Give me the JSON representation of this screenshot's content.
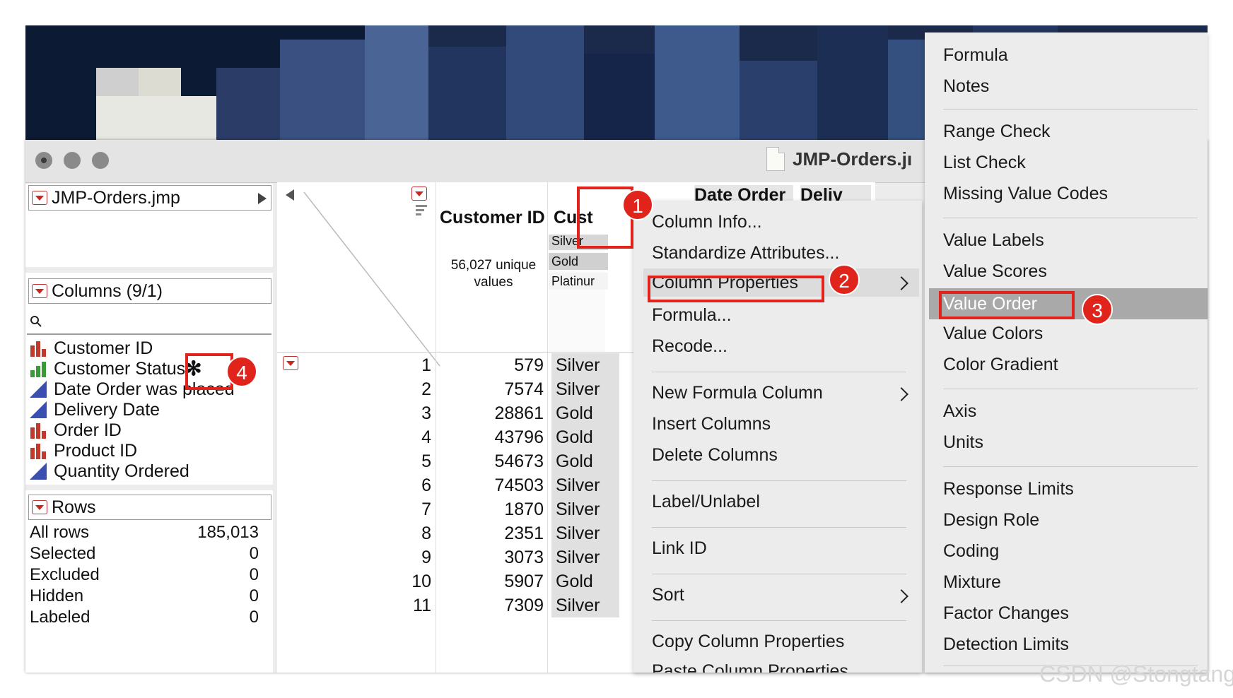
{
  "window": {
    "title": "JMP-Orders.jı"
  },
  "table_panel": {
    "title": "JMP-Orders.jmp"
  },
  "columns_panel": {
    "title": "Columns (9/1)",
    "items": [
      {
        "label": "Customer ID",
        "icon": "nominal-bar-icon",
        "color": "#c0392b"
      },
      {
        "label": "Customer Status",
        "icon": "ordinal-bar-icon",
        "color": "#3a9a3a"
      },
      {
        "label": "Date Order was placed",
        "icon": "continuous-triangle-icon",
        "color": "#3a4fb0"
      },
      {
        "label": "Delivery Date",
        "icon": "continuous-triangle-icon",
        "color": "#3a4fb0"
      },
      {
        "label": "Order ID",
        "icon": "nominal-bar-icon",
        "color": "#c0392b"
      },
      {
        "label": "Product ID",
        "icon": "nominal-bar-icon",
        "color": "#c0392b"
      },
      {
        "label": "Quantity Ordered",
        "icon": "continuous-triangle-icon",
        "color": "#3a4fb0"
      }
    ],
    "asterisk": "✻"
  },
  "rows_panel": {
    "title": "Rows",
    "stats": [
      {
        "label": "All rows",
        "value": "185,013"
      },
      {
        "label": "Selected",
        "value": "0"
      },
      {
        "label": "Excluded",
        "value": "0"
      },
      {
        "label": "Hidden",
        "value": "0"
      },
      {
        "label": "Labeled",
        "value": "0"
      }
    ]
  },
  "grid": {
    "col_customer_id": "Customer ID",
    "col_customer_status": "Cust",
    "col_date_order": "Date Order",
    "col_delivery": "Deliv",
    "summary": "56,027 unique values",
    "status_levels": [
      "Silver",
      "Gold",
      "Platinur"
    ],
    "rows": [
      {
        "n": "1",
        "id": "579",
        "status": "Silver"
      },
      {
        "n": "2",
        "id": "7574",
        "status": "Silver"
      },
      {
        "n": "3",
        "id": "28861",
        "status": "Gold"
      },
      {
        "n": "4",
        "id": "43796",
        "status": "Gold"
      },
      {
        "n": "5",
        "id": "54673",
        "status": "Gold"
      },
      {
        "n": "6",
        "id": "74503",
        "status": "Silver"
      },
      {
        "n": "7",
        "id": "1870",
        "status": "Silver"
      },
      {
        "n": "8",
        "id": "2351",
        "status": "Silver"
      },
      {
        "n": "9",
        "id": "3073",
        "status": "Silver"
      },
      {
        "n": "10",
        "id": "5907",
        "status": "Gold"
      },
      {
        "n": "11",
        "id": "7309",
        "status": "Silver"
      }
    ]
  },
  "context_menu": {
    "items": [
      "Column Info...",
      "Standardize Attributes...",
      "Column Properties",
      "Formula...",
      "Recode...",
      "New Formula Column",
      "Insert Columns",
      "Delete Columns",
      "Label/Unlabel",
      "Link ID",
      "Sort",
      "Copy Column Properties",
      "Paste Column Properties"
    ]
  },
  "submenu": {
    "items": [
      "Formula",
      "Notes",
      "Range Check",
      "List Check",
      "Missing Value Codes",
      "Value Labels",
      "Value Scores",
      "Value Order",
      "Value Colors",
      "Color Gradient",
      "Axis",
      "Units",
      "Response Limits",
      "Design Role",
      "Coding",
      "Mixture",
      "Factor Changes",
      "Detection Limits"
    ],
    "highlighted": "Value Order",
    "highlight_color": "#a9a9a9"
  },
  "annotations": {
    "badges": [
      "1",
      "2",
      "3",
      "4"
    ],
    "color": "#e1241b"
  },
  "watermark": "CSDN @Stongtang"
}
